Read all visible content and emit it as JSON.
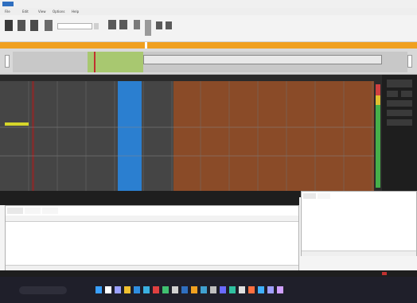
{
  "window": {
    "title": "",
    "menu_items": [
      "File",
      "Edit",
      "View",
      "Options",
      "Help"
    ]
  },
  "toolbar": {
    "time_value": "",
    "group_labels": [
      "",
      ""
    ]
  },
  "overview": {
    "selection_label": "",
    "tick_labels": []
  },
  "main_view": {
    "title": "",
    "x_tick_labels": [
      "",
      "",
      "",
      "",
      "",
      "",
      "",
      "",
      "",
      "",
      "",
      "",
      ""
    ],
    "columns": [
      {
        "kind": "gray",
        "color": "#454545"
      },
      {
        "kind": "gray-red-marker",
        "color": "#454545"
      },
      {
        "kind": "gray",
        "color": "#454545"
      },
      {
        "kind": "gray",
        "color": "#454545"
      },
      {
        "kind": "selected",
        "color": "#2b7fd0"
      },
      {
        "kind": "gray",
        "color": "#454545"
      },
      {
        "kind": "orange",
        "color": "#8a4b28"
      }
    ],
    "cursor_marker_color": "#d6d62a"
  },
  "right_panel": {
    "buttons": [
      "",
      "",
      "",
      "",
      "",
      ""
    ]
  },
  "bottom_left_panel": {
    "tabs": [
      "",
      "",
      ""
    ],
    "columns": [
      "",
      "",
      "",
      ""
    ],
    "rows": [
      [
        "",
        "",
        "",
        ""
      ]
    ]
  },
  "bottom_right_panel": {
    "tabs": [
      "",
      ""
    ],
    "table_rows": [
      [
        "",
        "",
        "",
        ""
      ],
      [
        "",
        "",
        "",
        ""
      ]
    ]
  },
  "taskbar": {
    "search_placeholder": "",
    "icons": [
      "start-icon",
      "search-icon",
      "taskview-icon",
      "explorer-icon",
      "edge-icon",
      "store-icon",
      "mail-icon",
      "app-icon",
      "app-icon",
      "app-icon",
      "app-icon",
      "app-icon",
      "app-icon",
      "app-icon",
      "app-icon",
      "app-icon",
      "app-icon",
      "app-icon",
      "app-icon",
      "app-icon"
    ],
    "clock": ""
  },
  "colors": {
    "accent_orange": "#f0a020",
    "dark_bg": "#1e1e1e",
    "plot_bg": "#454545",
    "selected_blue": "#2b7fd0",
    "orange_region": "#8a4b28",
    "level_green": "#46b04a"
  }
}
